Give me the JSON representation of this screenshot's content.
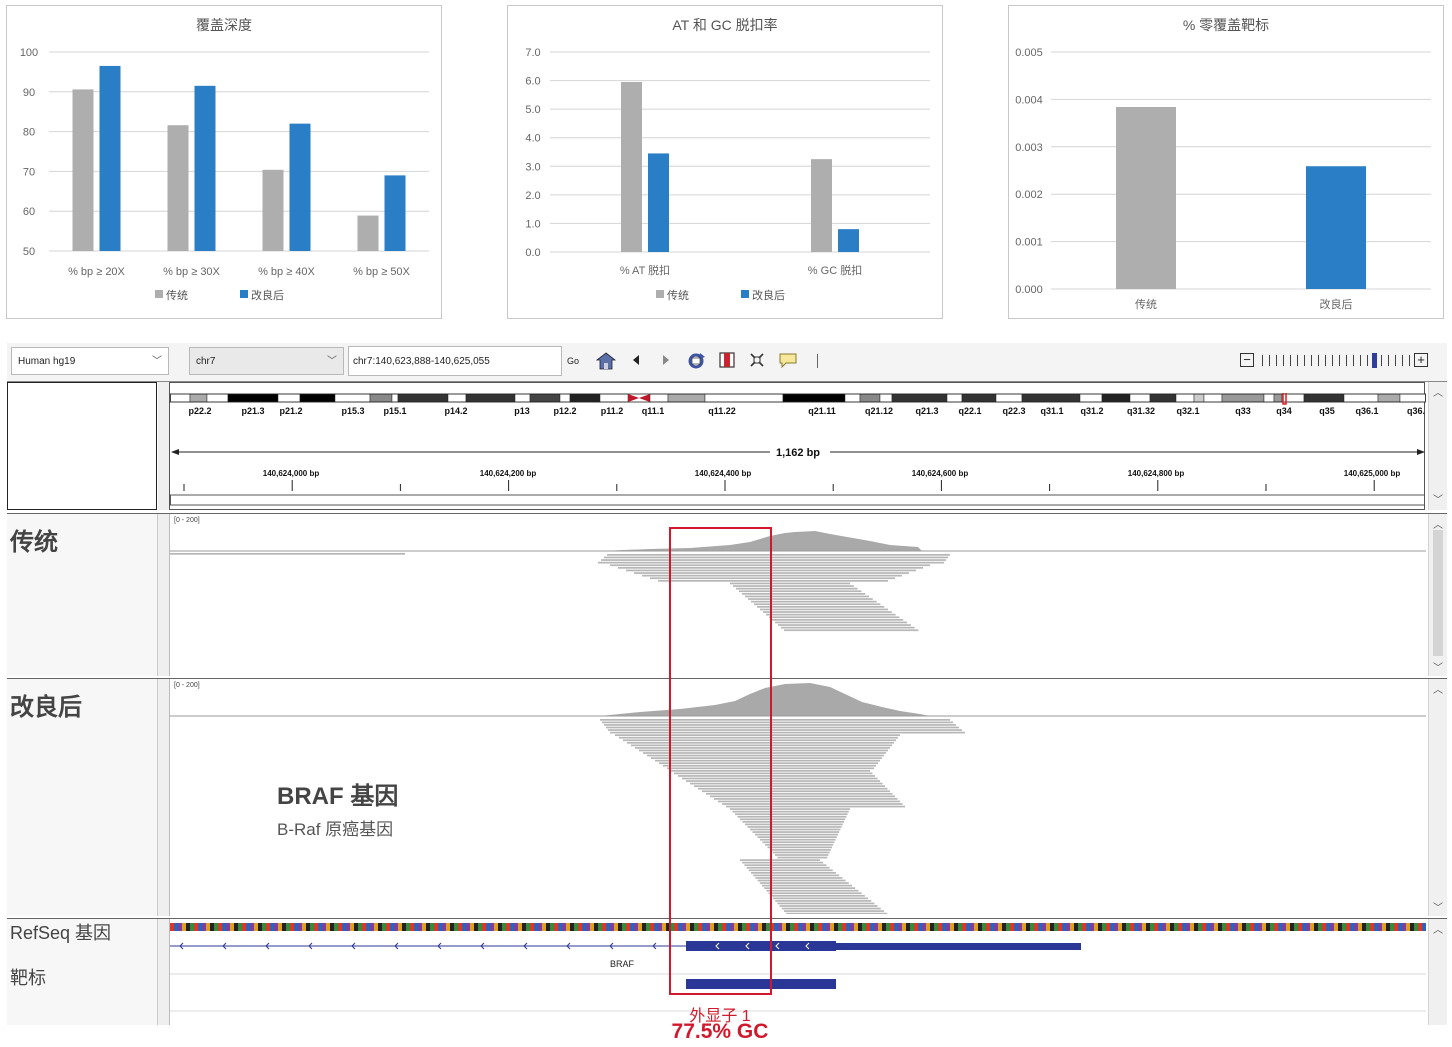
{
  "charts": [
    {
      "type": "bar",
      "title": "覆盖深度",
      "categories": [
        "% bp ≥ 20X",
        "% bp ≥ 30X",
        "% bp ≥ 40X",
        "% bp ≥ 50X"
      ],
      "series": [
        {
          "name": "传统",
          "color": "#aeaeae",
          "values": [
            90.6,
            81.6,
            70.4,
            58.9
          ]
        },
        {
          "name": "改良后",
          "color": "#2a7ec6",
          "values": [
            96.5,
            91.5,
            82.0,
            69.0
          ]
        }
      ],
      "ylim": [
        50,
        100
      ],
      "ticks": [
        "50",
        "60",
        "70",
        "80",
        "90",
        "100"
      ],
      "tick_values": [
        50,
        60,
        70,
        80,
        90,
        100
      ],
      "legend": [
        "传统",
        "改良后"
      ]
    },
    {
      "type": "bar",
      "title": "AT 和 GC 脱扣率",
      "categories": [
        "% AT 脱扣",
        "% GC 脱扣"
      ],
      "series": [
        {
          "name": "传统",
          "color": "#aeaeae",
          "values": [
            5.95,
            3.25
          ]
        },
        {
          "name": "改良后",
          "color": "#2a7ec6",
          "values": [
            3.45,
            0.8
          ]
        }
      ],
      "ylim": [
        0,
        7
      ],
      "ticks": [
        "0.0",
        "1.0",
        "2.0",
        "3.0",
        "4.0",
        "5.0",
        "6.0",
        "7.0"
      ],
      "tick_values": [
        0,
        1,
        2,
        3,
        4,
        5,
        6,
        7
      ],
      "legend": [
        "传统",
        "改良后"
      ]
    },
    {
      "type": "bar",
      "title": "% 零覆盖靶标",
      "categories": [
        "传统",
        "改良后"
      ],
      "series": [
        {
          "name": "",
          "colors": [
            "#aeaeae",
            "#2a7ec6"
          ],
          "values": [
            0.00384,
            0.00259
          ]
        }
      ],
      "ylim": [
        0,
        0.005
      ],
      "ticks": [
        "0.000",
        "0.001",
        "0.002",
        "0.003",
        "0.004",
        "0.005"
      ],
      "tick_values": [
        0,
        0.001,
        0.002,
        0.003,
        0.004,
        0.005
      ],
      "legend": []
    }
  ],
  "chart_data": [
    {
      "type": "bar",
      "title": "覆盖深度",
      "categories": [
        "% bp ≥ 20X",
        "% bp ≥ 30X",
        "% bp ≥ 40X",
        "% bp ≥ 50X"
      ],
      "series": [
        {
          "name": "传统",
          "values": [
            90.6,
            81.6,
            70.4,
            58.9
          ]
        },
        {
          "name": "改良后",
          "values": [
            96.5,
            91.5,
            82.0,
            69.0
          ]
        }
      ],
      "ylim": [
        50,
        100
      ]
    },
    {
      "type": "bar",
      "title": "AT 和 GC 脱扣率",
      "categories": [
        "% AT 脱扣",
        "% GC 脱扣"
      ],
      "series": [
        {
          "name": "传统",
          "values": [
            5.95,
            3.25
          ]
        },
        {
          "name": "改良后",
          "values": [
            3.45,
            0.8
          ]
        }
      ],
      "ylim": [
        0,
        7
      ]
    },
    {
      "type": "bar",
      "title": "% 零覆盖靶标",
      "categories": [
        "传统",
        "改良后"
      ],
      "series": [
        {
          "name": "",
          "values": [
            0.00384,
            0.00259
          ]
        }
      ],
      "ylim": [
        0,
        0.005
      ]
    }
  ],
  "igv": {
    "genome": "Human hg19",
    "chrom": "chr7",
    "locus": "chr7:140,623,888-140,625,055",
    "go": "Go",
    "icons": [
      "home-icon",
      "back-icon",
      "forward-icon",
      "refresh-icon",
      "region-icon",
      "fit-icon",
      "popup-text-icon"
    ],
    "cytobands": [
      "p22.2",
      "p21.3",
      "p21.2",
      "p15.3",
      "p15.1",
      "p14.2",
      "p13",
      "p12.2",
      "p11.2",
      "q11.1",
      "q11.22",
      "q21.11",
      "q21.12",
      "q21.3",
      "q22.1",
      "q22.3",
      "q31.1",
      "q31.2",
      "q31.32",
      "q32.1",
      "q33",
      "q34",
      "q35",
      "q36.1",
      "q36."
    ],
    "span": "1,162 bp",
    "positions": [
      "140,624,000 bp",
      "140,624,200 bp",
      "140,624,400 bp",
      "140,624,600 bp",
      "140,624,800 bp",
      "140,625,000 bp"
    ],
    "tracks": {
      "conventional": {
        "name": "传统",
        "range": "[0 - 200]"
      },
      "improved": {
        "name": "改良后",
        "range": "[0 - 200]"
      },
      "refseq": {
        "name": "RefSeq 基因",
        "gene": "BRAF"
      },
      "targets": {
        "name": "靶标"
      }
    },
    "gene_annotation": {
      "title": "BRAF 基因",
      "subtitle": "B-Raf 原癌基因"
    },
    "exon": {
      "label": "外显子 1",
      "gc": "77.5% GC"
    }
  }
}
